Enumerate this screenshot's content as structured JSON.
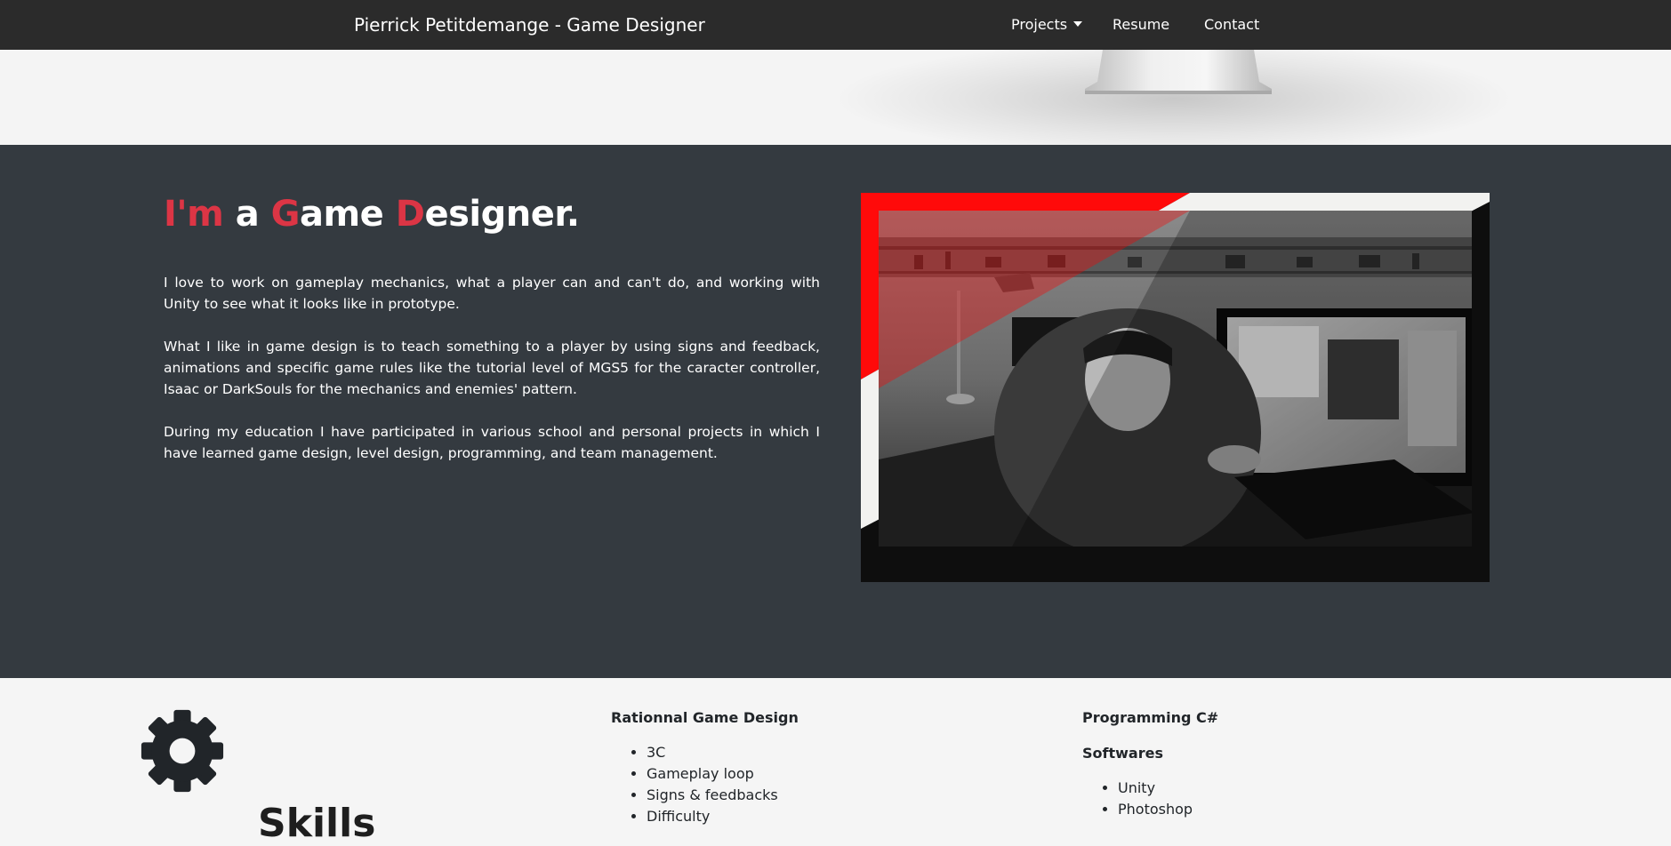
{
  "navbar": {
    "brand": "Pierrick Petitdemange - Game Designer",
    "links": {
      "projects": "Projects",
      "resume": "Resume",
      "contact": "Contact"
    }
  },
  "about": {
    "headline_parts": [
      "I'm",
      " a ",
      "G",
      "ame ",
      "D",
      "esigner."
    ],
    "paragraphs": [
      "I love to work on gameplay mechanics, what a player can and can't do, and working with Unity to see what it looks like in prototype.",
      "What I like in game design is to teach something to a player by using signs and feedback, animations and specific game rules like the tutorial level of MGS5 for the caracter controller, Isaac or DarkSouls for the mechanics and enemies' pattern.",
      "During my education I have participated in various school and personal projects in which I have learned game design, level design, programming, and team management."
    ]
  },
  "skills": {
    "title": "Skills",
    "col1": {
      "heading": "Rationnal Game Design",
      "items": [
        "3C",
        "Gameplay loop",
        "Signs & feedbacks",
        "Difficulty"
      ]
    },
    "col2": {
      "heading1": "Programming C#",
      "heading2": "Softwares",
      "items": [
        "Unity",
        "Photoshop"
      ]
    }
  },
  "colors": {
    "navbar": "#2b2b2b",
    "section_dark": "#343a40",
    "accent_red": "#dc3545",
    "photo_red": "#ff0000"
  },
  "icons": {
    "dropdown": "caret-down-icon",
    "skills": "gear-icon"
  }
}
